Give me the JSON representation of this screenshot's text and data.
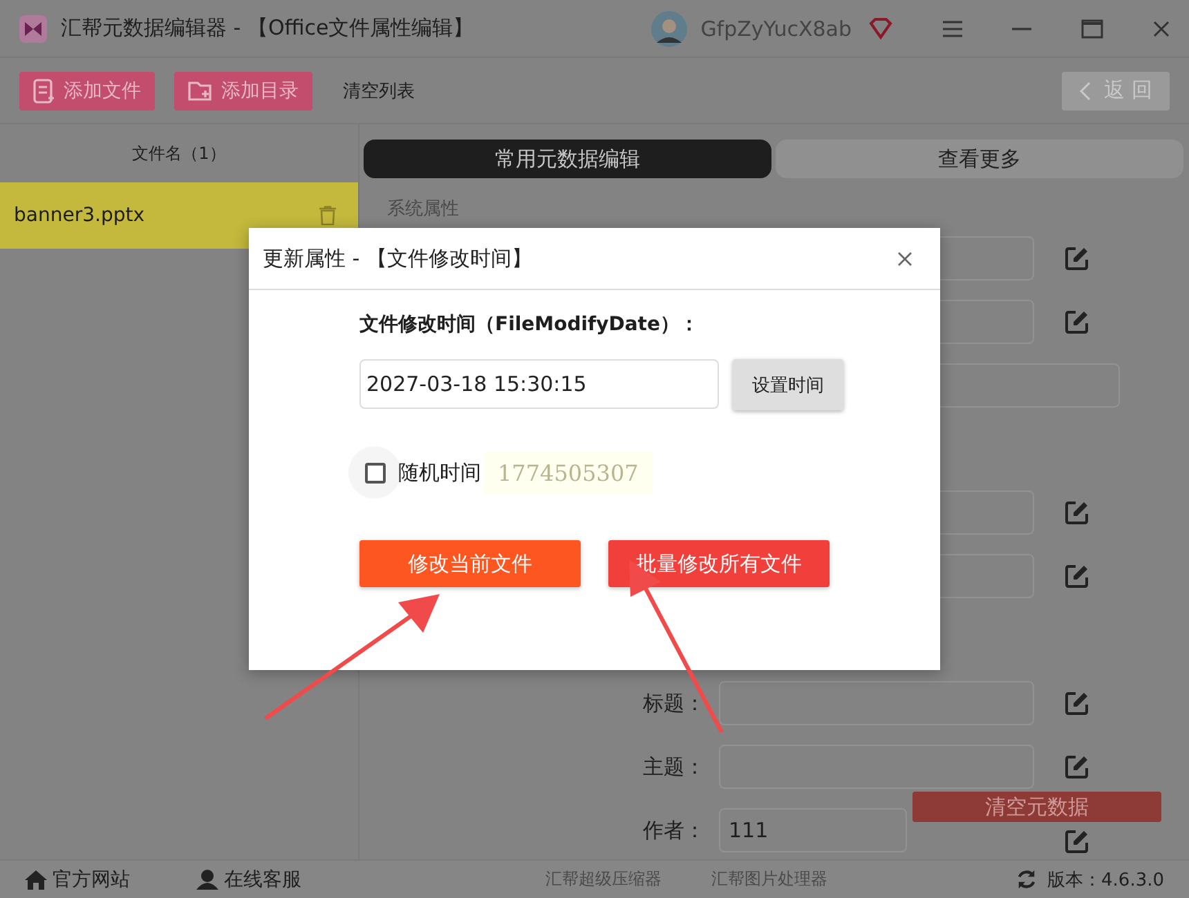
{
  "window": {
    "title": "汇帮元数据编辑器 - 【Office文件属性编辑】",
    "user": "GfpZyYucX8ab"
  },
  "toolbar": {
    "buttons": [
      {
        "label": "添加文件",
        "kind": "file"
      },
      {
        "label": "添加目录",
        "kind": "folder"
      },
      {
        "label": "清空列表",
        "kind": "plain"
      }
    ],
    "back": "返 回"
  },
  "file_list": {
    "header": "文件名（1）",
    "files": [
      {
        "name": "banner3.pptx",
        "selected": true
      }
    ]
  },
  "tabs": [
    {
      "label": "常用元数据编辑",
      "selected": true
    },
    {
      "label": "查看更多",
      "selected": false
    }
  ],
  "section": "系统属性",
  "fields": [
    {
      "kind": "field"
    },
    {
      "kind": "field"
    },
    {
      "kind": "wide"
    },
    {
      "kind": "blank"
    },
    {
      "kind": "field"
    },
    {
      "kind": "field"
    },
    {
      "kind": "blank"
    },
    {
      "kind": "field",
      "label": "标题："
    },
    {
      "kind": "field",
      "label": "主题："
    },
    {
      "kind": "field",
      "label": "作者：",
      "value": "111"
    }
  ],
  "clear_metadata": "清空元数据",
  "dialog": {
    "title": "更新属性 - 【文件修改时间】",
    "field_label": "文件修改时间（FileModifyDate）：",
    "value": "2027-03-18 15:30:15",
    "set_button": "设置时间",
    "random": {
      "label": "随机时间",
      "checked": false
    },
    "timestamp": "1774505307",
    "buttons": [
      {
        "label": "修改当前文件",
        "kind": "primary"
      },
      {
        "label": "批量修改所有文件",
        "kind": "danger"
      }
    ]
  },
  "footer": {
    "links": [
      {
        "label": "官方网站",
        "kind": "home"
      },
      {
        "label": "在线客服",
        "kind": "support"
      }
    ],
    "products": [
      "汇帮超级压缩器",
      "汇帮图片处理器"
    ],
    "version": "版本：4.6.3.0"
  }
}
